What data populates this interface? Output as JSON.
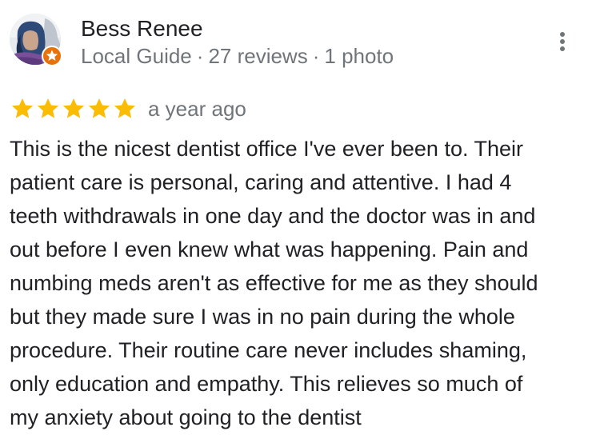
{
  "reviewer": {
    "name": "Bess Renee",
    "badge": "Local Guide",
    "review_count": "27 reviews",
    "photo_count": "1 photo",
    "avatar_icon": "user-avatar-photo",
    "badge_icon": "local-guide-star-badge"
  },
  "review": {
    "rating": 5,
    "max_rating": 5,
    "date": "a year ago",
    "text": "This is the nicest dentist office I've ever been to. Their\npatient care is personal, caring and attentive. I had 4\nteeth withdrawals in one day and the doctor was in and\nout before I even knew what was happening. Pain and\nnumbing meds aren't as effective for me as they should\nbut they made sure I was in no pain during the whole\nprocedure. Their routine care never includes shaming,\nonly education and empathy. This relieves so much of\nmy anxiety about going to the dentist"
  },
  "menu": {
    "icon": "more-vert-icon"
  },
  "colors": {
    "star": "#fbbc04",
    "badge": "#e8710a",
    "secondary_text": "#70757a",
    "primary_text": "#202124"
  }
}
